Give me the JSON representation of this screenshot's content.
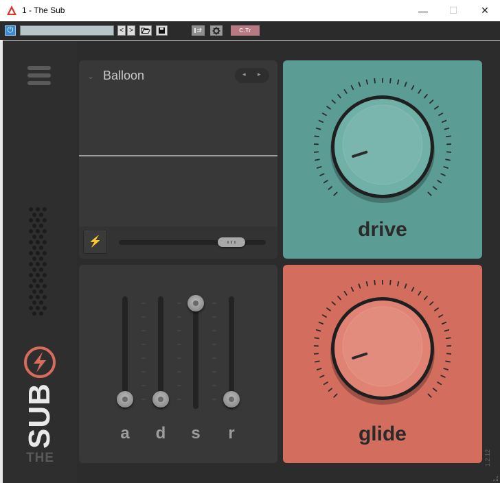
{
  "window": {
    "title": "1 - The Sub",
    "minimize_glyph": "—",
    "maximize_glyph": "☐",
    "close_glyph": "✕"
  },
  "host_toolbar": {
    "power_glyph": "⏻",
    "preset_value": "",
    "prev_glyph": "<",
    "next_glyph": ">",
    "open_icon": "folder-open-icon",
    "save_icon": "save-icon",
    "routing_icon": "routing-icon",
    "settings_icon": "gear-icon",
    "ctr_label": "C.Tr",
    "colors": {
      "power": "#3a8ad6",
      "preset_field": "#b7c4c8",
      "ctr": "#b87a82"
    }
  },
  "plugin": {
    "brand": {
      "sub": "SUB",
      "the": "THE"
    },
    "oscillator": {
      "preset_name": "Balloon",
      "prev_glyph": "◂",
      "next_glyph": "▸",
      "bolt_glyph": "⚡",
      "slider_value": 0.76
    },
    "envelope": {
      "sliders": [
        {
          "label": "a",
          "value": 0.0
        },
        {
          "label": "d",
          "value": 0.0
        },
        {
          "label": "s",
          "value": 1.0
        },
        {
          "label": "r",
          "value": 0.0
        }
      ]
    },
    "drive": {
      "label": "drive",
      "value": 0.1,
      "color": "#5b9d95",
      "knob_color": "#6fb0a7"
    },
    "glide": {
      "label": "glide",
      "value": 0.1,
      "color": "#d36e5f",
      "knob_color": "#e08374"
    },
    "version": "1.2.12"
  }
}
